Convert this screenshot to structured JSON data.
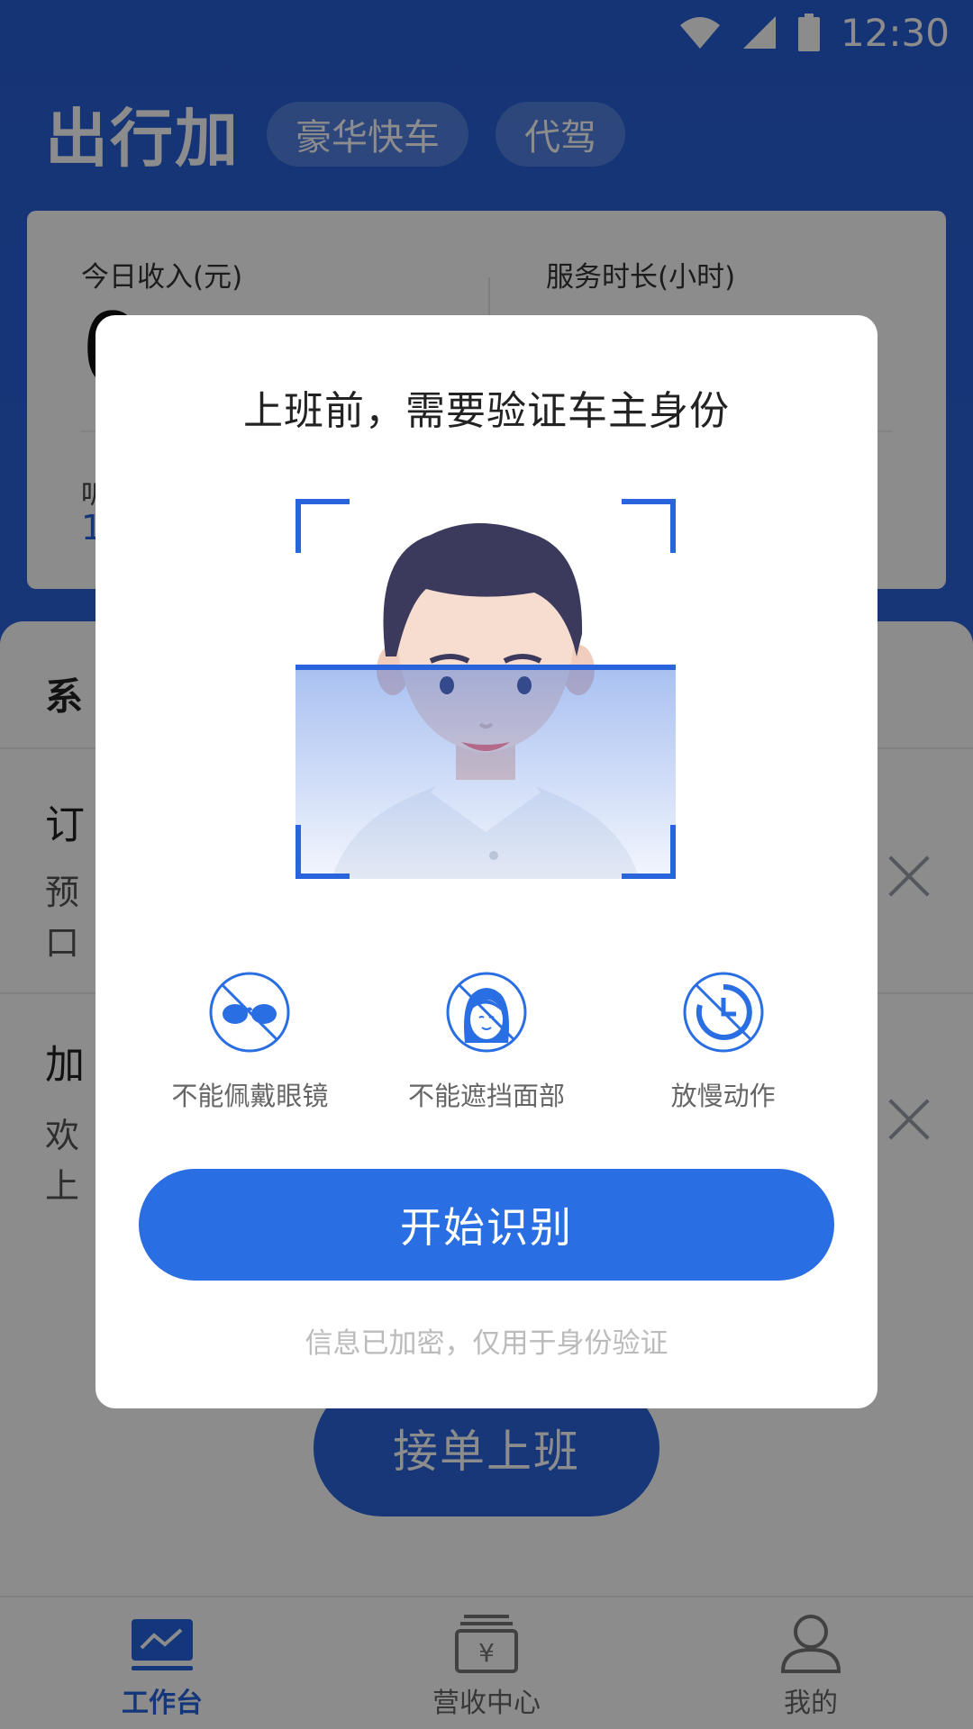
{
  "status_bar": {
    "time": "12:30"
  },
  "header": {
    "logo": "出行加",
    "tabs": [
      {
        "label": "豪华快车"
      },
      {
        "label": "代驾"
      }
    ]
  },
  "stats": {
    "income_label": "今日收入(元)",
    "income_value": "0",
    "hours_label": "服务时长(小时)",
    "secondary_label": "听",
    "secondary_value": "1"
  },
  "sheet": {
    "title": "系",
    "messages": [
      {
        "title": "订",
        "line1": "预",
        "line2": "口"
      },
      {
        "title": "加",
        "line1": "欢",
        "line2": "上"
      }
    ]
  },
  "go_button": {
    "label": "接单上班"
  },
  "tabbar": {
    "items": [
      {
        "label": "工作台",
        "icon": "dashboard-icon",
        "active": true
      },
      {
        "label": "营收中心",
        "icon": "yuan-box-icon",
        "active": false
      },
      {
        "label": "我的",
        "icon": "user-icon",
        "active": false
      }
    ]
  },
  "dialog": {
    "title": "上班前，需要验证车主身份",
    "tips": [
      {
        "label": "不能佩戴眼镜",
        "icon": "no-glasses-icon"
      },
      {
        "label": "不能遮挡面部",
        "icon": "no-face-cover-icon"
      },
      {
        "label": "放慢动作",
        "icon": "slow-clock-icon"
      }
    ],
    "start_button": "开始识别",
    "privacy_note": "信息已加密，仅用于身份验证"
  },
  "colors": {
    "primary": "#2a64dc",
    "button": "#2a6ee3",
    "overlay": "rgba(0,0,0,0.45)"
  }
}
